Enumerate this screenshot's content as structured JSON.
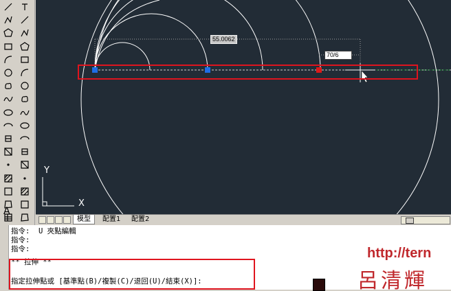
{
  "toolbar_left": {
    "tools": [
      "line",
      "polyline",
      "polygon",
      "rectangle",
      "arc",
      "circle",
      "cloud",
      "spline",
      "ellipse",
      "ellipse-arc",
      "insert-block",
      "make-block",
      "point",
      "hatch",
      "gradient",
      "region",
      "table",
      "text",
      "match-properties",
      "copy",
      "mirror",
      "offset",
      "array",
      "move",
      "rotate",
      "scale",
      "stretch",
      "trim",
      "extend",
      "break",
      "join",
      "chamfer",
      "fillet",
      "explode"
    ]
  },
  "canvas": {
    "dim_readout_length": "55.0062",
    "dim_input_value": "70/6",
    "ucs_x": "X",
    "ucs_y": "Y",
    "colors": {
      "background": "#222c36",
      "geometry": "#ffffff",
      "grip_cold": "#1e6ee6",
      "grip_hot": "#e01818",
      "highlight": "#e0141e"
    }
  },
  "tabs": {
    "model": "模型",
    "layout1": "配置1",
    "layout2": "配置2"
  },
  "command": {
    "lines": [
      "指令:  U 夾點編輯",
      "指令:",
      "指令:",
      "** 拉伸 **",
      "指定拉伸點或 [基準點(B)/複製(C)/退回(U)/結束(X)]:"
    ]
  },
  "ad": {
    "url": "http://tern",
    "text": "呂清輝"
  }
}
